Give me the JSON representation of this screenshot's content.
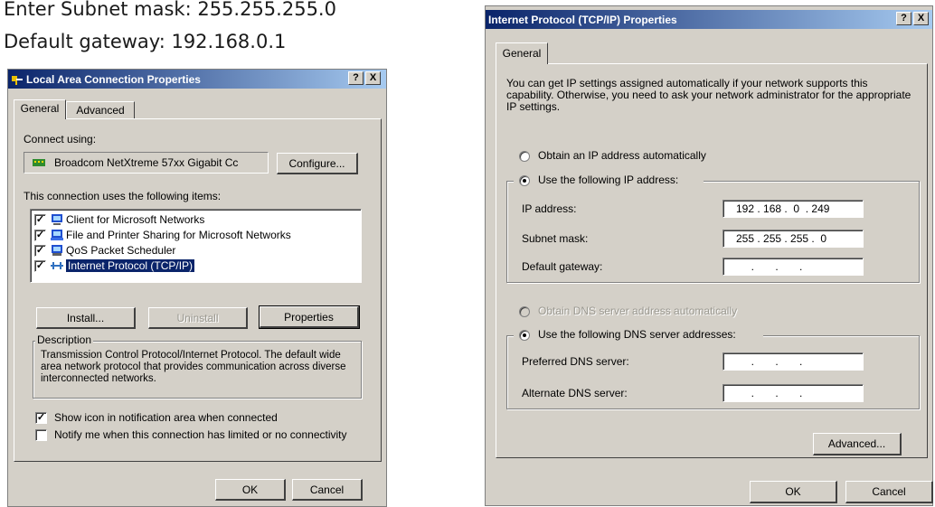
{
  "caption": {
    "line1": "Enter Subnet mask: 255.255.255.0",
    "line2": "Default gateway: 192.168.0.1"
  },
  "lac": {
    "title": "Local Area Connection Properties",
    "help": "?",
    "close": "X",
    "tabs": [
      "General",
      "Advanced"
    ],
    "connect_using_label": "Connect using:",
    "adapter_name": "Broadcom NetXtreme 57xx Gigabit Cc",
    "configure_label": "Configure...",
    "items_label": "This connection uses the following items:",
    "items": [
      {
        "label": "Client for Microsoft Networks",
        "checked": true,
        "icon": "network-client-icon"
      },
      {
        "label": "File and Printer Sharing for Microsoft Networks",
        "checked": true,
        "icon": "file-printer-sharing-icon"
      },
      {
        "label": "QoS Packet Scheduler",
        "checked": true,
        "icon": "qos-scheduler-icon"
      },
      {
        "label": "Internet Protocol (TCP/IP)",
        "checked": true,
        "icon": "protocol-icon",
        "selected": true
      }
    ],
    "install_label": "Install...",
    "uninstall_label": "Uninstall",
    "properties_label": "Properties",
    "description_title": "Description",
    "description_text": "Transmission Control Protocol/Internet Protocol. The default wide area network protocol that provides communication across diverse interconnected networks.",
    "show_icon_label": "Show icon in notification area when connected",
    "show_icon_checked": true,
    "notify_label": "Notify me when this connection has limited or no connectivity",
    "notify_checked": false,
    "ok_label": "OK",
    "cancel_label": "Cancel"
  },
  "tcp": {
    "title": "Internet Protocol (TCP/IP) Properties",
    "help": "?",
    "close": "X",
    "tab": "General",
    "intro": "You can get IP settings assigned automatically if your network supports this capability. Otherwise, you need to ask your network administrator for the appropriate IP settings.",
    "obtain_ip_label": "Obtain an IP address automatically",
    "use_ip_label": "Use the following IP address:",
    "ip_label": "IP address:",
    "ip_value": "192 . 168 .  0  . 249",
    "subnet_label": "Subnet mask:",
    "subnet_value": "255 . 255 . 255 .  0",
    "gateway_label": "Default gateway:",
    "gateway_value": "     .       .       .",
    "obtain_dns_label": "Obtain DNS server address automatically",
    "use_dns_label": "Use the following DNS server addresses:",
    "preferred_dns_label": "Preferred DNS server:",
    "preferred_dns_value": "     .       .       .",
    "alternate_dns_label": "Alternate DNS server:",
    "alternate_dns_value": "     .       .       .",
    "advanced_label": "Advanced...",
    "ok_label": "OK",
    "cancel_label": "Cancel"
  },
  "colors": {
    "title_gradient_start": "#0a246a",
    "title_gradient_end": "#a6caf0",
    "dialog_bg": "#d4d0c8",
    "selection": "#0a246a"
  }
}
